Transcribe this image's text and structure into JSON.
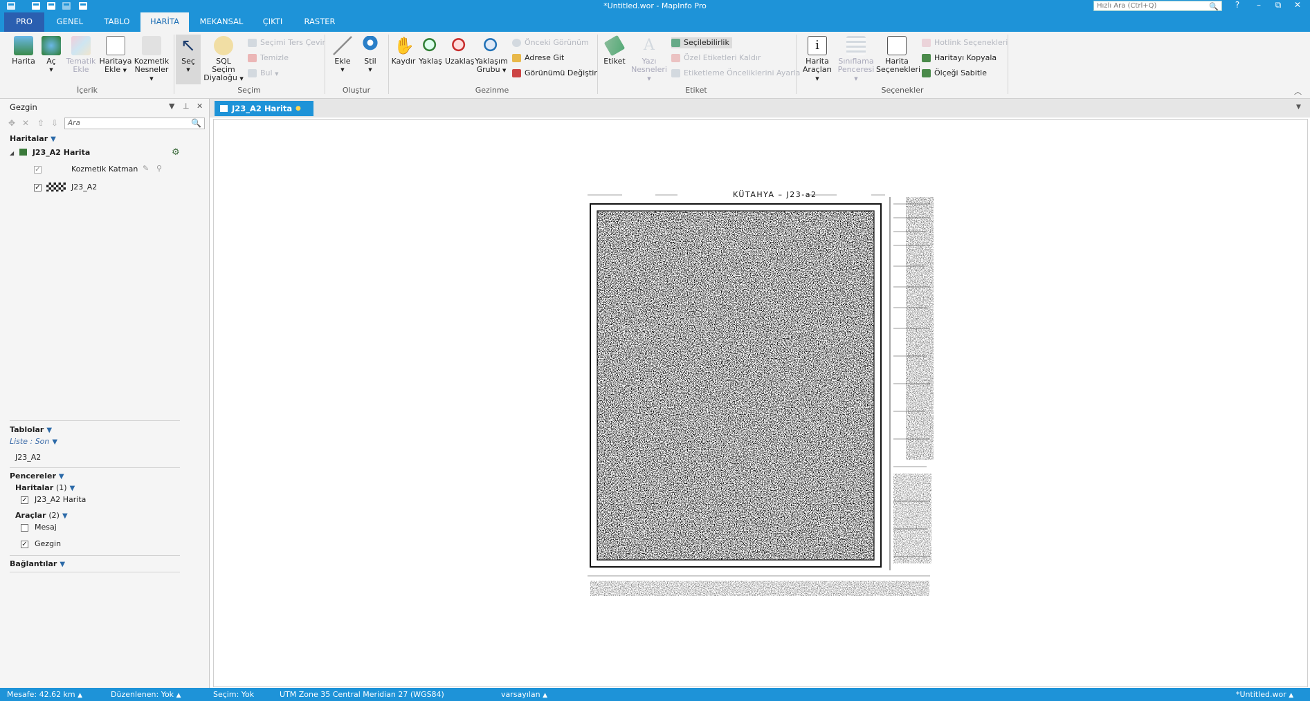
{
  "app": {
    "title": "*Untitled.wor - MapInfo Pro"
  },
  "quick_search": {
    "placeholder": "Hızlı Ara (Ctrl+Q)"
  },
  "window_controls": {
    "help": "?",
    "minimize": "–",
    "restore": "⧉",
    "close": "✕"
  },
  "tabs": [
    {
      "label": "PRO"
    },
    {
      "label": "GENEL"
    },
    {
      "label": "TABLO"
    },
    {
      "label": "HARİTA"
    },
    {
      "label": "MEKANSAL"
    },
    {
      "label": "ÇIKTI"
    },
    {
      "label": "RASTER"
    }
  ],
  "ribbon": {
    "groups": {
      "content": "İçerik",
      "selection": "Seçim",
      "create": "Oluştur",
      "navigation": "Gezinme",
      "label": "Etiket",
      "options": "Seçenekler"
    },
    "buttons": {
      "harita": "Harita",
      "ac": "Aç",
      "tematik_1": "Tematik",
      "tematik_2": "Ekle",
      "haritaya_1": "Haritaya",
      "haritaya_2": "Ekle",
      "kozmetik_1": "Kozmetik",
      "kozmetik_2": "Nesneler",
      "sec": "Seç",
      "sql_1": "SQL Seçim",
      "sql_2": "Diyaloğu",
      "secimi_ters": "Seçimi Ters Çevir",
      "temizle": "Temizle",
      "bul": "Bul",
      "ekle": "Ekle",
      "stil": "Stil",
      "kaydir": "Kaydır",
      "yaklas": "Yaklaş",
      "uzaklas": "Uzaklaş",
      "yaklasim_1": "Yaklaşım",
      "yaklasim_2": "Grubu",
      "onceki": "Önceki Görünüm",
      "adrese_git": "Adrese Git",
      "gorunumu_degistir": "Görünümü Değiştir",
      "etiket": "Etiket",
      "yazi_1": "Yazı",
      "yazi_2": "Nesneleri",
      "secilebilirlik": "Seçilebilirlik",
      "ozel_etiketleri": "Özel Etiketleri Kaldır",
      "etiketleme_oncelik": "Etiketleme Önceliklerini Ayarla",
      "harita_araclari_1": "Harita",
      "harita_araclari_2": "Araçları",
      "siniflama_1": "Sınıflama",
      "siniflama_2": "Penceresi",
      "harita_secenekleri_1": "Harita",
      "harita_secenekleri_2": "Seçenekleri",
      "hotlink": "Hotlink Seçenekleri",
      "haritayi_kopyala": "Haritayı Kopyala",
      "olcegi_sabitle": "Ölçeği Sabitle"
    }
  },
  "explorer": {
    "title": "Gezgin",
    "search_placeholder": "Ara",
    "maps_header": "Haritalar",
    "map_name": "J23_A2 Harita",
    "layers": [
      {
        "name": "Kozmetik Katman",
        "checked": true
      },
      {
        "name": "J23_A2",
        "checked": true
      }
    ],
    "tables_header": "Tablolar",
    "list_mode": "Liste : Son",
    "tables": [
      "J23_A2"
    ],
    "windows_header": "Pencereler",
    "windows_maps_label": "Haritalar",
    "windows_maps_count": "(1)",
    "windows_maps": [
      {
        "name": "J23_A2 Harita",
        "checked": true
      }
    ],
    "tools_label": "Araçlar",
    "tools_count": "(2)",
    "tools": [
      {
        "name": "Mesaj",
        "checked": false
      },
      {
        "name": "Gezgin",
        "checked": true
      }
    ],
    "connections_header": "Bağlantılar"
  },
  "document": {
    "tab_label": "J23_A2 Harita",
    "map_sheet_title": "KÜTAHYA – J23-a2"
  },
  "status_bar": {
    "distance": "Mesafe: 42.62 km",
    "editing": "Düzenlenen: Yok",
    "selection": "Seçim: Yok",
    "projection": "UTM Zone 35 Central Meridian 27 (WGS84)",
    "style": "varsayılan",
    "workspace": "*Untitled.wor"
  },
  "colors": {
    "accent": "#1e93d8",
    "pro_tab": "#2a5fb0",
    "ribbon_bg": "#f3f3f3"
  }
}
